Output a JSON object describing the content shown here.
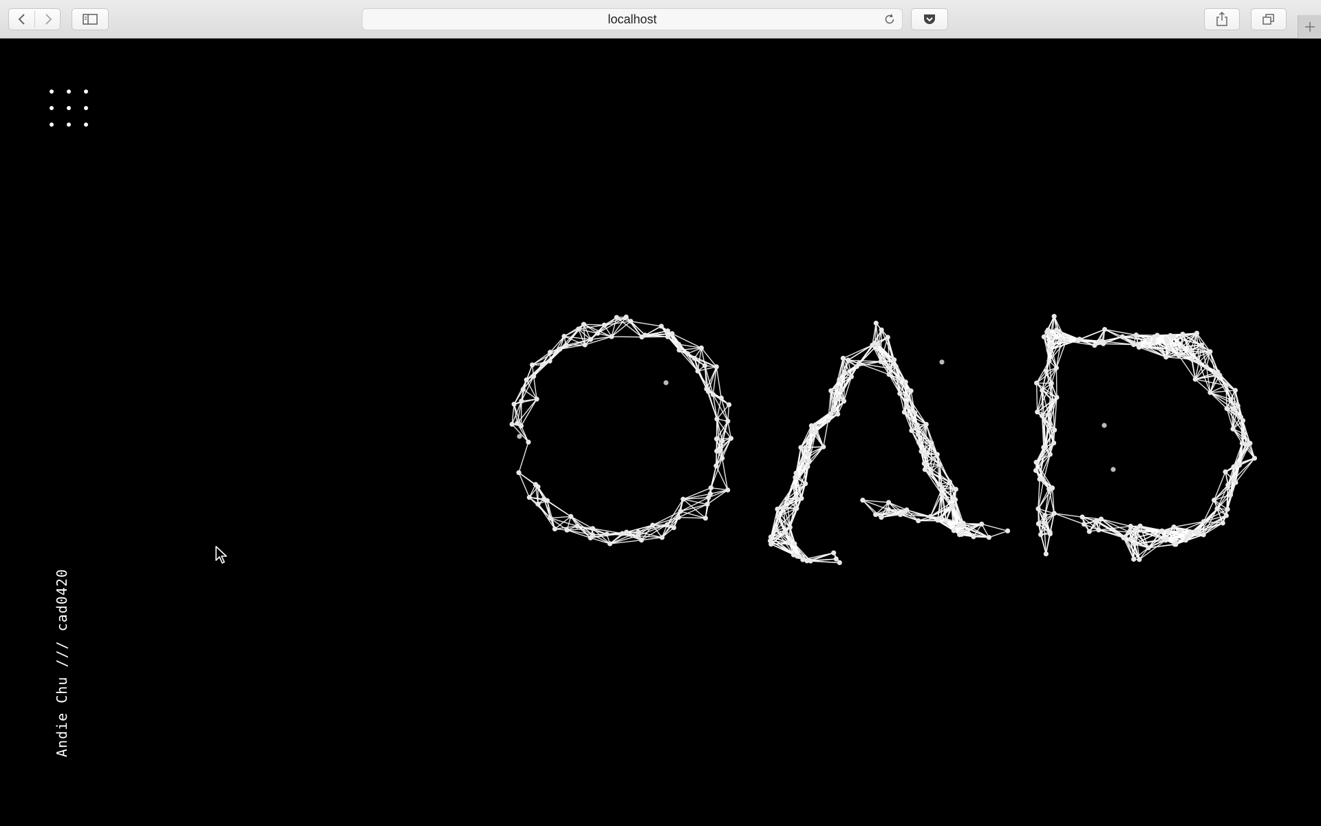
{
  "browser": {
    "url": "localhost",
    "icons": {
      "back": "chevron-left-icon",
      "forward": "chevron-right-icon",
      "sidebar": "sidebar-icon",
      "reload": "reload-icon",
      "pocket": "pocket-icon",
      "share": "share-icon",
      "tabs": "tabs-overview-icon",
      "new_tab": "plus-icon"
    }
  },
  "page": {
    "menu_icon": "grid-menu-icon",
    "credit": "Andie Chu /// cad0420",
    "hero_letters": [
      "c",
      "a",
      "d"
    ],
    "background_color": "#000000",
    "node_color": "#ffffff"
  }
}
